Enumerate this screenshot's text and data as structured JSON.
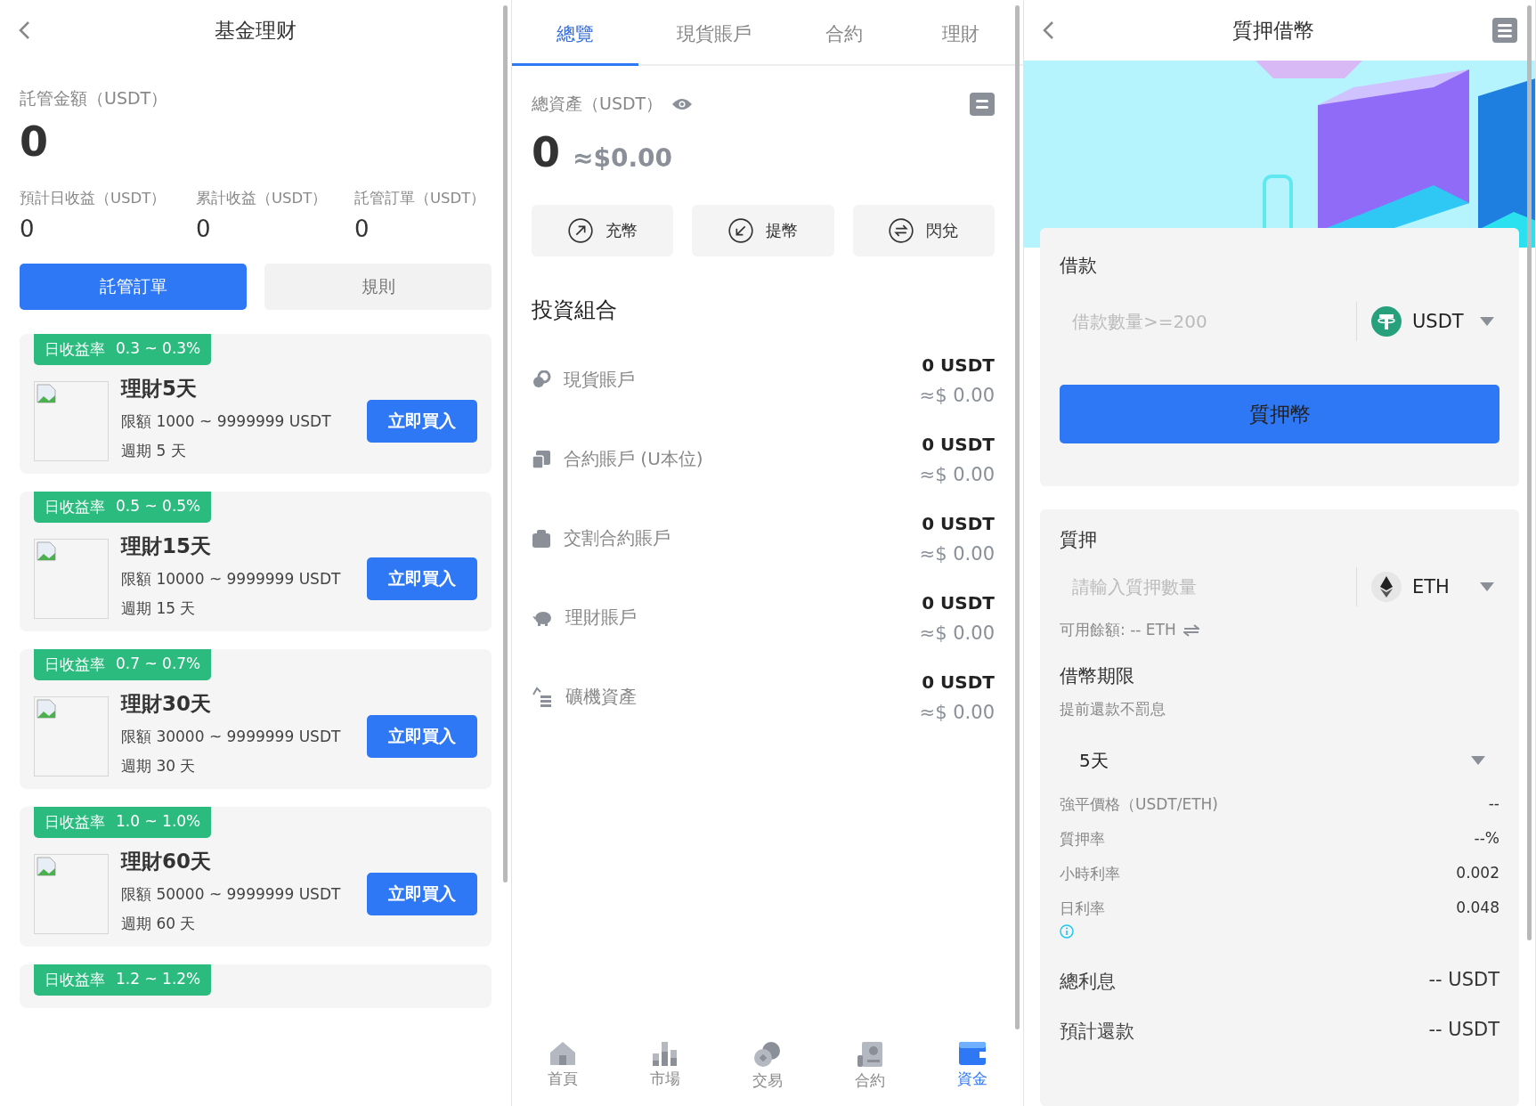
{
  "fund_panel": {
    "title": "基金理财",
    "custody_label": "託管金額（USDT）",
    "custody_amount": "0",
    "stats": [
      {
        "label": "預計日收益（USDT）",
        "value": "0"
      },
      {
        "label": "累計收益（USDT）",
        "value": "0"
      },
      {
        "label": "託管訂單（USDT）",
        "value": "0"
      }
    ],
    "buttons": [
      {
        "label": "託管訂單",
        "selected": true
      },
      {
        "label": "規則",
        "selected": false
      }
    ],
    "products": [
      {
        "rate_label": "日收益率",
        "rate": "0.3 ~ 0.3%",
        "name": "理財5天",
        "limit": "限額 1000 ~ 9999999 USDT",
        "period": "週期 5 天",
        "action": "立即買入"
      },
      {
        "rate_label": "日收益率",
        "rate": "0.5 ~ 0.5%",
        "name": "理財15天",
        "limit": "限額 10000 ~ 9999999 USDT",
        "period": "週期 15 天",
        "action": "立即買入"
      },
      {
        "rate_label": "日收益率",
        "rate": "0.7 ~ 0.7%",
        "name": "理財30天",
        "limit": "限額 30000 ~ 9999999 USDT",
        "period": "週期 30 天",
        "action": "立即買入"
      },
      {
        "rate_label": "日收益率",
        "rate": "1.0 ~ 1.0%",
        "name": "理財60天",
        "limit": "限額 50000 ~ 9999999 USDT",
        "period": "週期 60 天",
        "action": "立即買入"
      },
      {
        "rate_label": "日收益率",
        "rate": "1.2 ~ 1.2%"
      }
    ]
  },
  "assets_panel": {
    "tabs": [
      {
        "label": "總覽",
        "selected": true
      },
      {
        "label": "現貨賬戶",
        "selected": false
      },
      {
        "label": "合約",
        "selected": false
      },
      {
        "label": "理財",
        "selected": false
      }
    ],
    "total_label": "總資產（USDT）",
    "total": "0",
    "total_fiat": "≈$0.00",
    "actions": [
      {
        "label": "充幣",
        "kind": "deposit"
      },
      {
        "label": "提幣",
        "kind": "withdraw"
      },
      {
        "label": "閃兌",
        "kind": "swap"
      }
    ],
    "portfolio_title": "投資組合",
    "accounts": [
      {
        "kind": "spot",
        "name": "現貨賬戶",
        "amount": "0 USDT",
        "fiat": "≈$ 0.00"
      },
      {
        "kind": "contract",
        "name": "合約賬戶 (U本位)",
        "amount": "0 USDT",
        "fiat": "≈$ 0.00"
      },
      {
        "kind": "delivery",
        "name": "交割合約賬戶",
        "amount": "0 USDT",
        "fiat": "≈$ 0.00"
      },
      {
        "kind": "finance",
        "name": "理財賬戶",
        "amount": "0 USDT",
        "fiat": "≈$ 0.00"
      },
      {
        "kind": "mining",
        "name": "礦機資產",
        "amount": "0 USDT",
        "fiat": "≈$ 0.00"
      }
    ],
    "nav": [
      {
        "kind": "home",
        "label": "首頁",
        "selected": false
      },
      {
        "kind": "market",
        "label": "市場",
        "selected": false
      },
      {
        "kind": "trade",
        "label": "交易",
        "selected": false
      },
      {
        "kind": "contract",
        "label": "合約",
        "selected": false
      },
      {
        "kind": "funds",
        "label": "資金",
        "selected": true
      }
    ]
  },
  "loan_panel": {
    "title": "質押借幣",
    "borrow": {
      "title": "借款",
      "placeholder": "借款數量>=200",
      "coin": "USDT",
      "submit": "質押幣"
    },
    "collateral": {
      "title": "質押",
      "placeholder": "請輸入質押數量",
      "coin": "ETH",
      "balance": "可用餘額:  -- ETH"
    },
    "term": {
      "title": "借幣期限",
      "note": "提前還款不罰息",
      "value": "5天"
    },
    "details": [
      {
        "label": "強平價格（USDT/ETH)",
        "value": "--"
      },
      {
        "label": "質押率",
        "value": "--%"
      },
      {
        "label": "小時利率",
        "value": "0.002"
      },
      {
        "label": "日利率",
        "value": "0.048"
      }
    ],
    "totals": [
      {
        "label": "總利息",
        "value": "-- USDT"
      },
      {
        "label": "預計還款",
        "value": "-- USDT"
      }
    ]
  }
}
